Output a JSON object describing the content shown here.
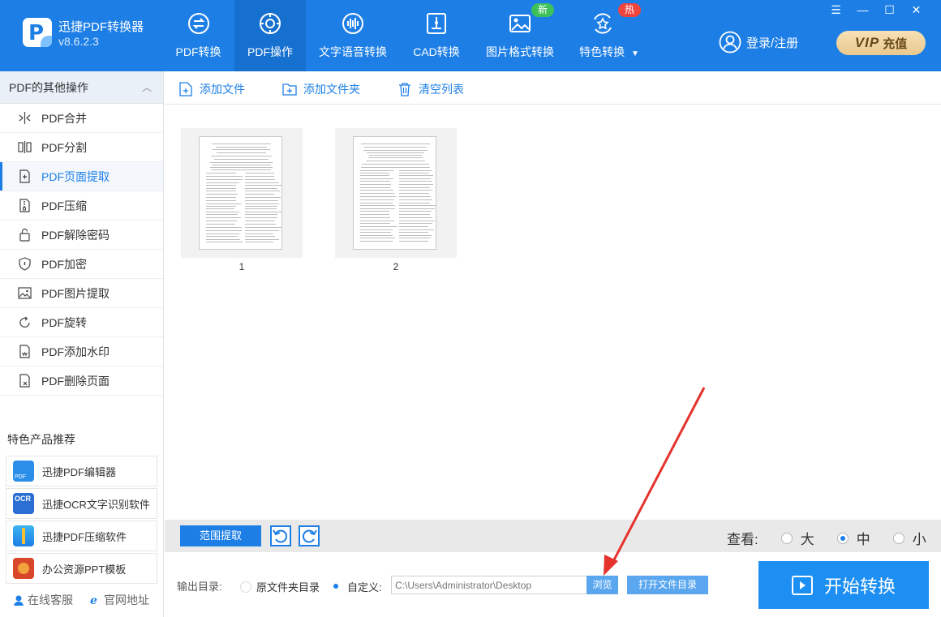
{
  "app": {
    "name": "迅捷PDF转换器",
    "version": "v8.6.2.3",
    "logo_letter": "P"
  },
  "nav": {
    "items": [
      {
        "label": "PDF转换",
        "icon": "pdf-convert-icon"
      },
      {
        "label": "PDF操作",
        "icon": "pdf-operate-icon",
        "active": true
      },
      {
        "label": "文字语音转换",
        "icon": "audio-wave-icon"
      },
      {
        "label": "CAD转换",
        "icon": "cad-icon"
      },
      {
        "label": "图片格式转换",
        "icon": "image-icon",
        "badge": "新"
      },
      {
        "label": "特色转换",
        "icon": "star-refresh-icon",
        "badge": "热"
      }
    ],
    "dropdown_glyph": "▼"
  },
  "window_controls": {
    "menu": "☰",
    "minimize": "—",
    "maximize": "☐",
    "close": "✕"
  },
  "account": {
    "login_label": "登录/注册",
    "vip_label": "VIP",
    "vip_action": "充值"
  },
  "sidebar": {
    "header": "PDF的其他操作",
    "collapse_glyph": "︿",
    "items": [
      {
        "label": "PDF合并",
        "icon": "merge-icon"
      },
      {
        "label": "PDF分割",
        "icon": "split-icon"
      },
      {
        "label": "PDF页面提取",
        "icon": "page-extract-icon",
        "active": true
      },
      {
        "label": "PDF压缩",
        "icon": "compress-icon"
      },
      {
        "label": "PDF解除密码",
        "icon": "unlock-icon"
      },
      {
        "label": "PDF加密",
        "icon": "shield-icon"
      },
      {
        "label": "PDF图片提取",
        "icon": "image-extract-icon"
      },
      {
        "label": "PDF旋转",
        "icon": "rotate-icon"
      },
      {
        "label": "PDF添加水印",
        "icon": "watermark-icon"
      },
      {
        "label": "PDF删除页面",
        "icon": "delete-page-icon"
      }
    ],
    "featured_title": "特色产品推荐",
    "products": [
      {
        "label": "迅捷PDF编辑器",
        "icon": "pdf-editor-icon",
        "tag": "PDF"
      },
      {
        "label": "迅捷OCR文字识别软件",
        "icon": "ocr-icon",
        "tag": "OCR"
      },
      {
        "label": "迅捷PDF压缩软件",
        "icon": "pdf-compress-icon"
      },
      {
        "label": "办公资源PPT模板",
        "icon": "ppt-template-icon"
      }
    ],
    "footer": {
      "support": "在线客服",
      "website": "官网地址"
    }
  },
  "toolbar": {
    "add_file": "添加文件",
    "add_folder": "添加文件夹",
    "clear_list": "清空列表"
  },
  "files": [
    {
      "label": "1"
    },
    {
      "label": "2"
    }
  ],
  "strip": {
    "range_button": "范围提取",
    "view_label": "查看:",
    "view_options": [
      {
        "label": "大"
      },
      {
        "label": "中",
        "selected": true
      },
      {
        "label": "小"
      }
    ]
  },
  "output": {
    "label": "输出目录:",
    "original_dir": "原文件夹目录",
    "custom": "自定义:",
    "selected": "custom",
    "path": "C:\\Users\\Administrator\\Desktop",
    "browse": "浏览",
    "open_dir": "打开文件目录",
    "start": "开始转换"
  },
  "colors": {
    "primary": "#1d7fe6",
    "header_active": "#1670d0",
    "badge_new": "#3cc15a",
    "badge_hot": "#f0453f",
    "annotation_arrow": "#e5322d"
  }
}
